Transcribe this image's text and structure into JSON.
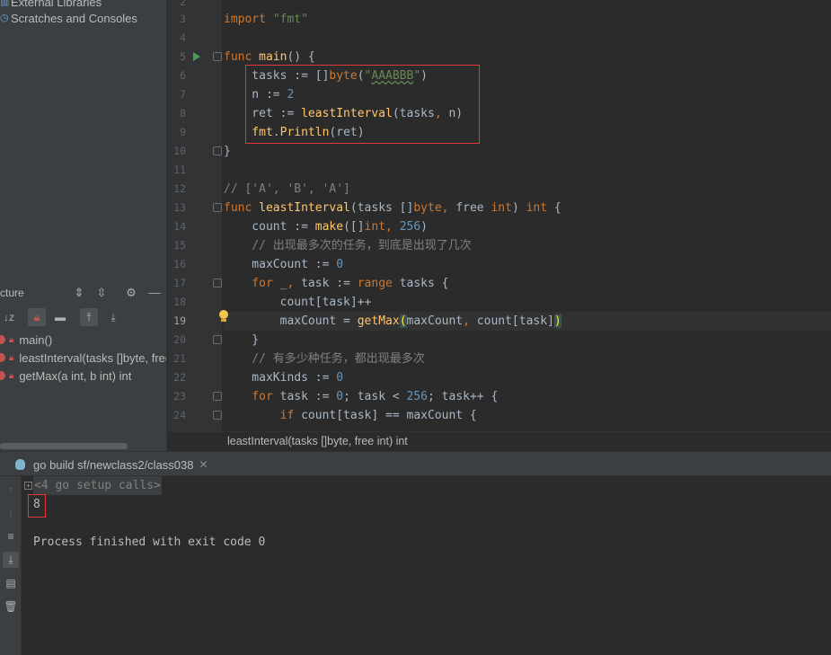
{
  "project": {
    "items": [
      "External Libraries",
      "Scratches and Consoles"
    ]
  },
  "structure": {
    "title": "cture",
    "items": [
      "main()",
      "leastInterval(tasks []byte, free int) int",
      "getMax(a int, b int) int"
    ]
  },
  "editor": {
    "line_numbers": [
      "2",
      "3",
      "4",
      "5",
      "6",
      "7",
      "8",
      "9",
      "10",
      "11",
      "12",
      "13",
      "14",
      "15",
      "16",
      "17",
      "18",
      "19",
      "20",
      "21",
      "22",
      "23",
      "24"
    ],
    "current_line": "19",
    "lines": {
      "l2": "",
      "l3_kw": "import ",
      "l3_str": "\"fmt\"",
      "l5_kw": "func ",
      "l5_fn": "main",
      "l5_rest": "() {",
      "l6_a": "    tasks := []",
      "l6_kw": "byte",
      "l6_b": "(",
      "l6_str_q1": "\"",
      "l6_str": "AAABBB",
      "l6_str_q2": "\"",
      "l6_c": ")",
      "l7_a": "    n := ",
      "l7_num": "2",
      "l8_a": "    ret := ",
      "l8_fn": "leastInterval",
      "l8_b": "(tasks",
      "l8_comma": ", ",
      "l8_c": "n)",
      "l9_pkg": "    fmt",
      "l9_a": ".",
      "l9_fn": "Println",
      "l9_b": "(ret)",
      "l10": "}",
      "l12_cmt": "// ['A', 'B', 'A']",
      "l13_kw": "func ",
      "l13_fn": "leastInterval",
      "l13_a": "(tasks []",
      "l13_kw2": "byte",
      "l13_comma": ", ",
      "l13_b": "free ",
      "l13_kw3": "int",
      "l13_c": ") ",
      "l13_kw4": "int",
      "l13_d": " {",
      "l14_a": "    count := ",
      "l14_fn": "make",
      "l14_b": "([]",
      "l14_kw": "int",
      "l14_comma": ", ",
      "l14_num": "256",
      "l14_c": ")",
      "l15_cmt": "    // 出现最多次的任务，到底是出现了几次",
      "l16_a": "    maxCount := ",
      "l16_num": "0",
      "l17_kw": "    for ",
      "l17_a": "_",
      "l17_comma": ", ",
      "l17_b": "task := ",
      "l17_kw2": "range ",
      "l17_c": "tasks {",
      "l18": "        count[task]++",
      "l19_a": "        maxCount = ",
      "l19_fn": "getMax",
      "l19_paren1": "(",
      "l19_b": "maxCount",
      "l19_comma": ", ",
      "l19_c": "count[task]",
      "l19_paren2": ")",
      "l20": "    }",
      "l21_cmt": "    // 有多少种任务，都出现最多次",
      "l22_a": "    maxKinds := ",
      "l22_num": "0",
      "l23_kw": "    for ",
      "l23_a": "task := ",
      "l23_num1": "0",
      "l23_b": "; task < ",
      "l23_num2": "256",
      "l23_c": "; task++ {",
      "l24_kw": "        if ",
      "l24_a": "count[task] == maxCount {"
    }
  },
  "breadcrumb": "leastInterval(tasks []byte, free int) int",
  "run": {
    "tab_label": "go build sf/newclass2/class038",
    "setup_calls": "<4 go setup calls>",
    "output": "8",
    "finished": "Process finished with exit code 0"
  },
  "colors": {
    "highlight_box": "#e0393e",
    "keyword": "#cc7832",
    "string": "#6a8759",
    "number": "#6897bb",
    "function": "#ffc66d",
    "comment": "#808080"
  },
  "icons": {
    "run_gutter": "play-triangle-icon",
    "intention": "lightbulb-icon",
    "run_tab": "gopher-icon"
  }
}
